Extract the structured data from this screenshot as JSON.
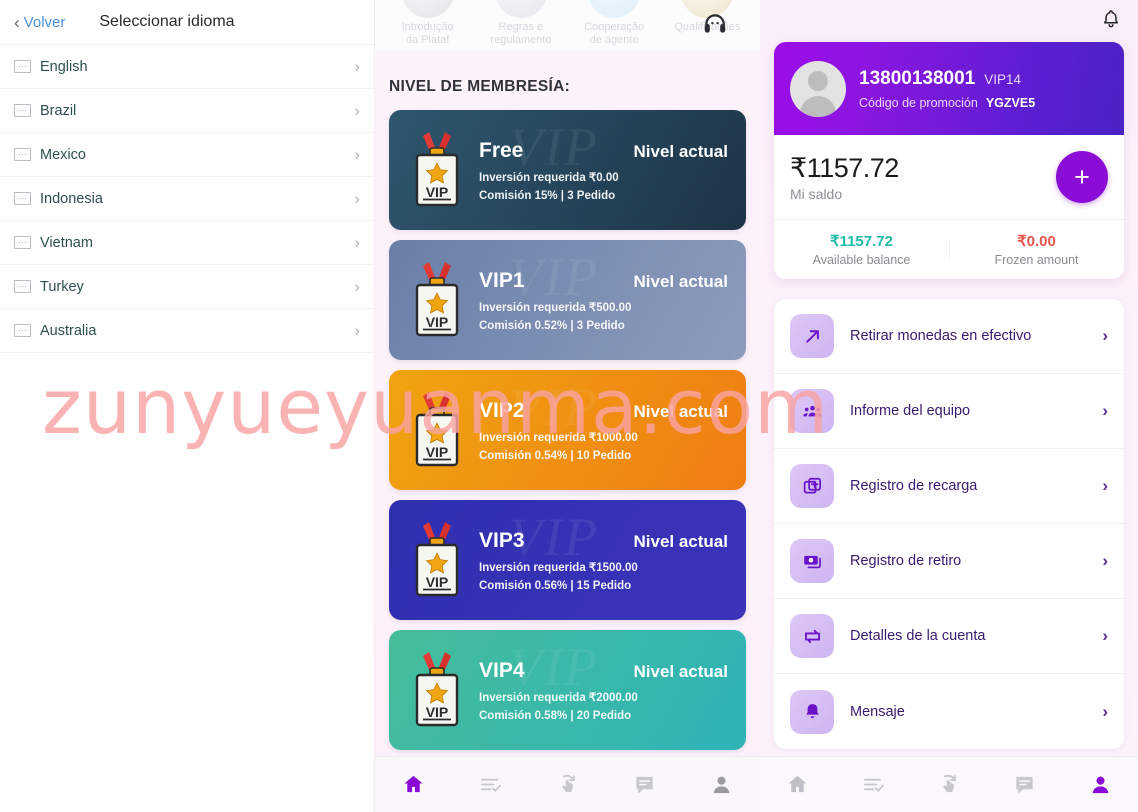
{
  "watermark": "zunyueyuanma.com",
  "language_panel": {
    "back_label": "Volver",
    "title": "Seleccionar idioma",
    "back_icon": "chevron-left-icon",
    "items": [
      {
        "label": "English",
        "icon": "flag-placeholder-icon",
        "chevron": "›"
      },
      {
        "label": "Brazil",
        "icon": "flag-placeholder-icon",
        "chevron": "›"
      },
      {
        "label": "Mexico",
        "icon": "flag-placeholder-icon",
        "chevron": "›"
      },
      {
        "label": "Indonesia",
        "icon": "flag-placeholder-icon",
        "chevron": "›"
      },
      {
        "label": "Vietnam",
        "icon": "flag-placeholder-icon",
        "chevron": "›"
      },
      {
        "label": "Turkey",
        "icon": "flag-placeholder-icon",
        "chevron": "›"
      },
      {
        "label": "Australia",
        "icon": "flag-placeholder-icon",
        "chevron": "›"
      }
    ]
  },
  "membership_panel": {
    "top_shortcuts": [
      {
        "label_line1": "Introdução",
        "label_line2": "da Plataf",
        "icon": "silver-coin-icon",
        "color": "#cfcfd6"
      },
      {
        "label_line1": "Regras e",
        "label_line2": "regulamento",
        "icon": "silver-coin-icon",
        "color": "#d5d5da"
      },
      {
        "label_line1": "Cooperação",
        "label_line2": "de agente",
        "icon": "blue-coin-icon",
        "color": "#cfe6f5"
      },
      {
        "label_line1": "Qualificações",
        "label_line2": "",
        "icon": "gold-coin-icon",
        "color": "#e8dcc0"
      }
    ],
    "support_icon": "headset-support-icon",
    "section_title": "NIVEL DE MEMBRESÍA:",
    "badge_icon": "vip-medal-badge-icon",
    "card_watermark": "VIP",
    "levels": [
      {
        "name": "Free",
        "status": "Nivel actual",
        "investment": "Inversión requerida ₹0.00",
        "commission": "Comisión 15% | 3 Pedido",
        "gradient_from": "#2e5770",
        "gradient_to": "#1e3446"
      },
      {
        "name": "VIP1",
        "status": "Nivel actual",
        "investment": "Inversión requerida ₹500.00",
        "commission": "Comisión 0.52% | 3 Pedido",
        "gradient_from": "#6a7fa8",
        "gradient_to": "#8d9cbc"
      },
      {
        "name": "VIP2",
        "status": "Nivel actual",
        "investment": "Inversión requerida ₹1000.00",
        "commission": "Comisión 0.54% | 10 Pedido",
        "gradient_from": "#f0a411",
        "gradient_to": "#ef7d12"
      },
      {
        "name": "VIP3",
        "status": "Nivel actual",
        "investment": "Inversión requerida ₹1500.00",
        "commission": "Comisión 0.56% | 15 Pedido",
        "gradient_from": "#2f30ae",
        "gradient_to": "#3c33bb"
      },
      {
        "name": "VIP4",
        "status": "Nivel actual",
        "investment": "Inversión requerida ₹2000.00",
        "commission": "Comisión 0.58% | 20 Pedido",
        "gradient_from": "#45bd9a",
        "gradient_to": "#2fb3b8"
      }
    ],
    "bottom_nav": [
      {
        "icon": "home-icon",
        "active": true
      },
      {
        "icon": "task-list-check-icon",
        "active": false
      },
      {
        "icon": "swipe-up-hand-icon",
        "active": false
      },
      {
        "icon": "chat-message-icon",
        "active": false
      },
      {
        "icon": "person-profile-icon",
        "active": false
      }
    ]
  },
  "account_panel": {
    "bell_icon": "notification-bell-icon",
    "profile": {
      "avatar_icon": "default-user-avatar-icon",
      "username": "13800138001",
      "vip_level": "VIP14",
      "promo_label": "Código de promoción",
      "promo_code": "YGZVE5"
    },
    "balance": {
      "amount": "₹1157.72",
      "label": "Mi saldo",
      "add_button_icon": "plus-icon",
      "available_amount": "₹1157.72",
      "available_label": "Available balance",
      "frozen_amount": "₹0.00",
      "frozen_label": "Frozen amount",
      "available_color": "#1fbba6",
      "frozen_color": "#e8554d"
    },
    "menu": [
      {
        "label": "Retirar monedas en efectivo",
        "icon": "arrow-up-right-withdraw-icon",
        "chevron": "›"
      },
      {
        "label": "Informe del equipo",
        "icon": "team-group-icon",
        "chevron": "›"
      },
      {
        "label": "Registro de recarga",
        "icon": "recharge-plus-card-icon",
        "chevron": "›"
      },
      {
        "label": "Registro de retiro",
        "icon": "banknote-withdraw-icon",
        "chevron": "›"
      },
      {
        "label": "Detalles de la cuenta",
        "icon": "transfer-exchange-icon",
        "chevron": "›"
      },
      {
        "label": "Mensaje",
        "icon": "bell-message-icon",
        "chevron": "›"
      }
    ],
    "bottom_nav": [
      {
        "icon": "home-icon",
        "active": false
      },
      {
        "icon": "task-list-check-icon",
        "active": false
      },
      {
        "icon": "swipe-up-hand-icon",
        "active": false
      },
      {
        "icon": "chat-message-icon",
        "active": false
      },
      {
        "icon": "person-profile-icon",
        "active": true
      }
    ]
  },
  "theme": {
    "accent_purple": "#8b0cd4",
    "menu_text": "#3a1a6e",
    "link_blue": "#4a90d9",
    "watermark_color": "#f9a3a3"
  }
}
